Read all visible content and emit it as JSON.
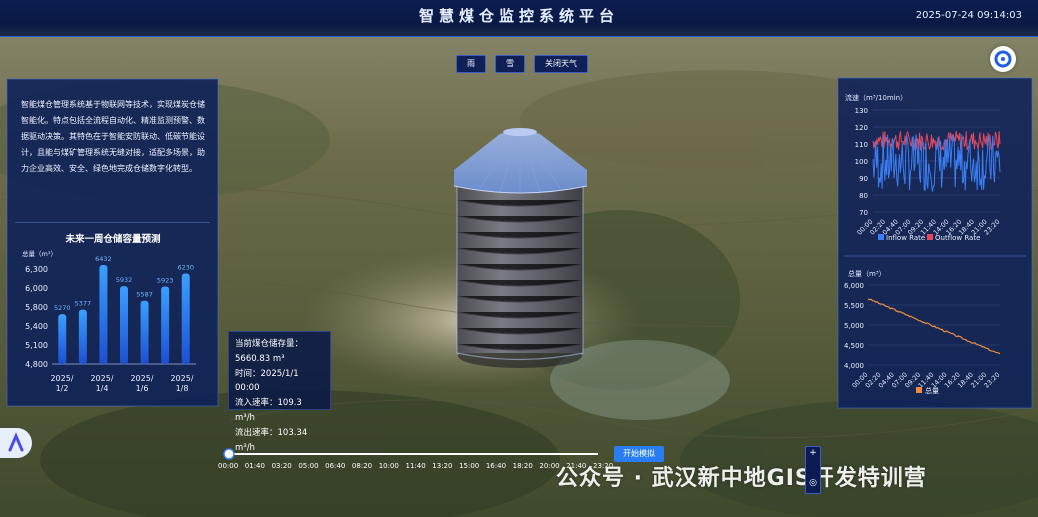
{
  "header": {
    "title": "智慧煤仓监控系统平台",
    "datetime": "2025-07-24 09:14:03"
  },
  "weather": {
    "rain": "雨",
    "snow": "雪",
    "off": "关闭天气"
  },
  "left_panel": {
    "intro": "智能煤仓管理系统基于物联网等技术，实现煤炭仓储智能化。特点包括全流程自动化、精准监测预警、数据驱动决策。其特色在于智能安防联动、低碳节能设计，且能与煤矿管理系统无缝对接，适配多场景，助力企业高效、安全、绿色地完成仓储数字化转型。",
    "chart_title": "未来一周仓储容量预测",
    "ylabel": "总量（m³）"
  },
  "info": {
    "storage_label": "当前煤仓储存量：",
    "storage_value": "5660.83 m³",
    "time": "时间：2025/1/1 00:00",
    "inflow": "流入速率：109.3 m³/h",
    "outflow": "流出速率：103.34 m³/h"
  },
  "playback": {
    "button": "开始模拟",
    "progress": 0
  },
  "watermark": "公众号 · 武汉新中地GIS开发特训营",
  "chart_data": [
    {
      "type": "bar",
      "categories": [
        "2025/1/2",
        "2025/1/4",
        "2025/1/6",
        "2025/1/8"
      ],
      "tick_labels": [
        [
          "2025/",
          "1/2"
        ],
        [
          "2025/",
          "1/4"
        ],
        [
          "2025/",
          "1/6"
        ],
        [
          "2025/",
          "1/8"
        ]
      ],
      "values": [
        5270,
        5377,
        6432,
        5932,
        5587,
        5923,
        6230
      ],
      "ylabel": "总量（m³）",
      "ylim": [
        4800,
        6500
      ],
      "yticks": [
        "6,300",
        "6,100",
        "6,000",
        "5,800",
        "5,600",
        "5,400",
        "5,100",
        "4,800"
      ],
      "colors": [
        "#1f5ee8",
        "#3aa0ff"
      ]
    },
    {
      "type": "line",
      "title": "流速（m³/10min）",
      "ylim": [
        70,
        130
      ],
      "yticks": [
        "130",
        "120",
        "110",
        "100",
        "90",
        "80",
        "70"
      ],
      "xticks": [
        "00:00",
        "02:20",
        "04:40",
        "07:00",
        "09:20",
        "11:40",
        "14:00",
        "16:20",
        "18:40",
        "21:00",
        "23:20"
      ],
      "series": [
        {
          "name": "Inflow Rate",
          "color": "#3a7ef5"
        },
        {
          "name": "Outflow Rate",
          "color": "#e4485a"
        }
      ]
    },
    {
      "type": "line",
      "title": "总量（m³）",
      "ylim": [
        4000,
        6000
      ],
      "yticks": [
        "6,000",
        "5,500",
        "5,000",
        "4,500",
        "4,000"
      ],
      "xticks": [
        "00:00",
        "02:20",
        "04:40",
        "07:00",
        "09:20",
        "11:40",
        "14:00",
        "16:20",
        "18:40",
        "21:00",
        "23:20"
      ],
      "series": [
        {
          "name": "总量",
          "color": "#f08a3c",
          "start": 5660,
          "end": 4270
        }
      ]
    }
  ],
  "timeline_ticks": [
    "00:00",
    "01:40",
    "03:20",
    "05:00",
    "06:40",
    "08:20",
    "10:00",
    "11:40",
    "13:20",
    "15:00",
    "16:40",
    "18:20",
    "20:00",
    "21:40",
    "23:20"
  ]
}
